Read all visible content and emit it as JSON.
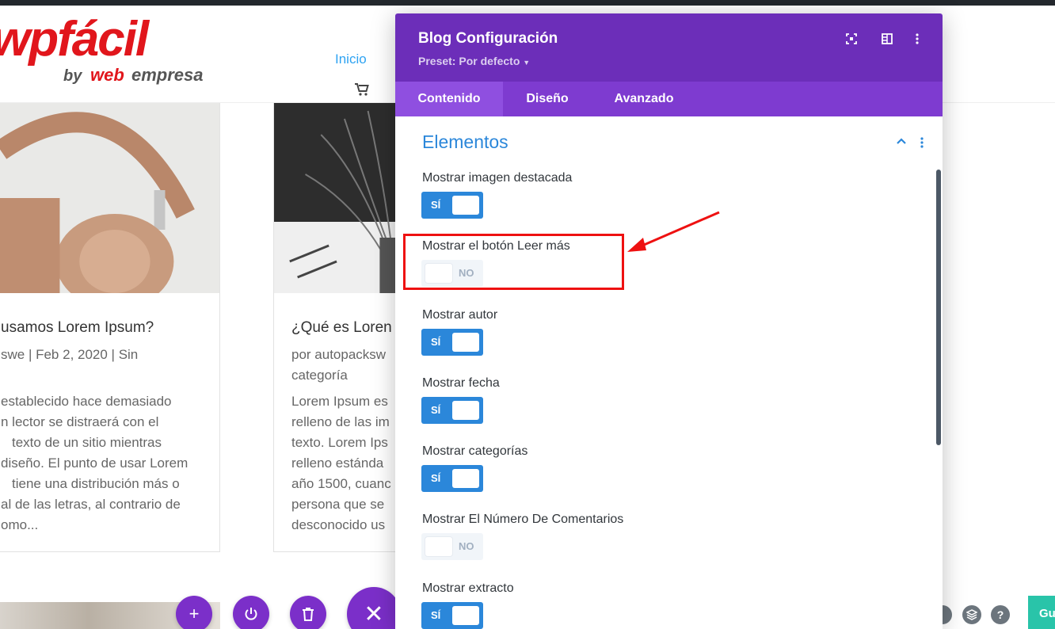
{
  "site": {
    "logo_main": "wpfácil",
    "logo_by": "by",
    "logo_brand_a": "web",
    "logo_brand_b": "empresa",
    "nav": {
      "inicio": "Inicio"
    }
  },
  "posts": [
    {
      "title": "usamos Lorem Ipsum?",
      "meta": [
        "swe | Feb 2, 2020 | Sin"
      ],
      "excerpt": [
        "establecido hace demasiado",
        "n lector se distraerá con el",
        "texto de un sitio mientras",
        "diseño. El punto de usar Lorem",
        "tiene una distribución más o",
        "al de las letras, al contrario de",
        "omo..."
      ]
    },
    {
      "title": "¿Qué es Loren",
      "meta": [
        "por autopacksw",
        "categoría"
      ],
      "excerpt": [
        "Lorem Ipsum es",
        "relleno de las im",
        "texto. Lorem Ips",
        "relleno estánda",
        "año 1500, cuanc",
        "persona que se",
        "desconocido us"
      ]
    }
  ],
  "panel": {
    "title": "Blog Configuración",
    "preset": "Preset: Por defecto",
    "tabs": [
      "Contenido",
      "Diseño",
      "Avanzado"
    ],
    "active_tab": "Contenido",
    "section_title": "Elementos",
    "fields": [
      {
        "label": "Mostrar imagen destacada",
        "state": "SÍ"
      },
      {
        "label": "Mostrar el botón Leer más",
        "state": "NO"
      },
      {
        "label": "Mostrar autor",
        "state": "SÍ"
      },
      {
        "label": "Mostrar fecha",
        "state": "SÍ"
      },
      {
        "label": "Mostrar categorías",
        "state": "SÍ"
      },
      {
        "label": "Mostrar El Número De Comentarios",
        "state": "NO"
      },
      {
        "label": "Mostrar extracto",
        "state": "SÍ"
      }
    ]
  },
  "builder": {
    "add": "+",
    "close": "✕",
    "help": "?",
    "save_label": "Gu"
  },
  "colors": {
    "panel_header": "#6c2eb9",
    "panel_tabs": "#7e3bd0",
    "toggle_on": "#2b87da",
    "highlight": "#ee1111",
    "fab": "#7b2fc9"
  }
}
